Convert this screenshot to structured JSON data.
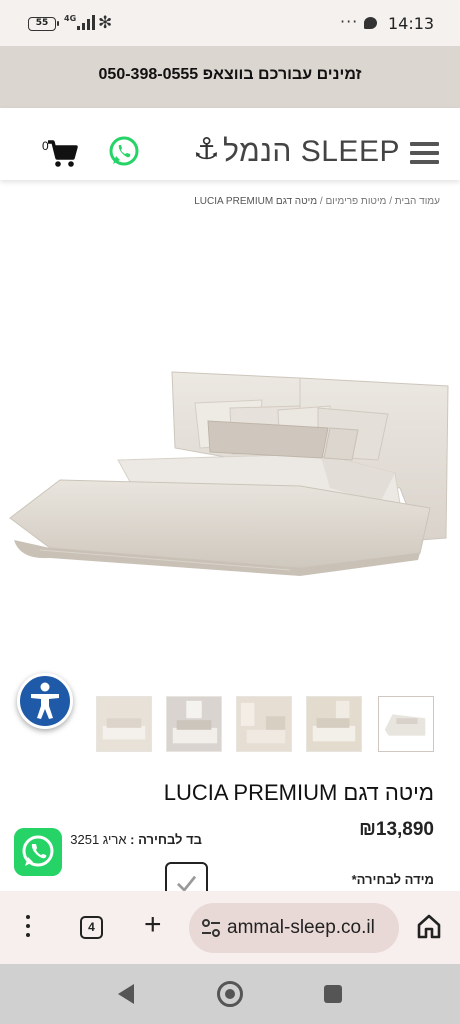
{
  "status_bar": {
    "battery": "55",
    "network": "4G",
    "time": "14:13",
    "icons": [
      "battery-icon",
      "signal-icon",
      "bluetooth-icon",
      "more-dots-icon",
      "chat-bubble-icon"
    ]
  },
  "promo": {
    "text": "זמינים עבורכם בווצאפ 050-398-0555"
  },
  "header": {
    "logo_text": "הנמל SLEEP",
    "cart_count": "0",
    "icons": [
      "menu-icon",
      "anchor-icon",
      "whatsapp-icon",
      "cart-icon"
    ]
  },
  "breadcrumb": {
    "items": [
      "עמוד הבית",
      "מיטות פרימיום",
      "מיטה דגם LUCIA PREMIUM"
    ],
    "separator": "/"
  },
  "product": {
    "title": "מיטה דגם LUCIA PREMIUM",
    "price": "₪13,890",
    "fabric_label": "בד לבחירה :",
    "fabric_value": "אריג 3251",
    "size_label": "מידה לבחירה*",
    "thumbnail_count": 5
  },
  "browser": {
    "tab_count": "4",
    "url": "ammal-sleep.co.il",
    "icons": [
      "more-vert-icon",
      "tabs-icon",
      "plus-icon",
      "site-settings-icon",
      "home-icon"
    ]
  },
  "colors": {
    "promo_bg": "#dcd6d1",
    "whatsapp_green": "#25d366",
    "accessibility_blue": "#1f5aa8",
    "browser_bar_bg": "#f7efee"
  }
}
